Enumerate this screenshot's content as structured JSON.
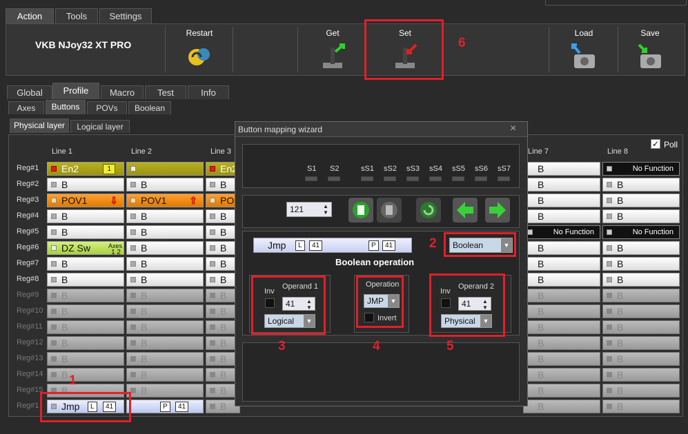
{
  "tabs_top": [
    "Action",
    "Tools",
    "Settings"
  ],
  "device_name": "VKB NJoy32 XT PRO",
  "toolbar": {
    "restart": "Restart",
    "get": "Get",
    "set": "Set",
    "load": "Load",
    "save": "Save"
  },
  "tabs_main": [
    "Global",
    "Profile",
    "Macro",
    "Test",
    "Info"
  ],
  "tabs_sub": [
    "Axes",
    "Buttons",
    "POVs",
    "Boolean"
  ],
  "tabs_layer": [
    "Physical layer",
    "Logical layer"
  ],
  "poll_label": "Poll",
  "columns": [
    "Line 1",
    "Line 2",
    "Line 3",
    "Line 7",
    "Line 8"
  ],
  "rows": [
    "Reg#1",
    "Reg#2",
    "Reg#3",
    "Reg#4",
    "Reg#5",
    "Reg#6",
    "Reg#7",
    "Reg#8",
    "Reg#9",
    "Reg#10",
    "Reg#11",
    "Reg#12",
    "Reg#13",
    "Reg#14",
    "Reg#15",
    "Reg#1"
  ],
  "cells": {
    "en2": "En2",
    "en2_badge": "1",
    "en2_short": "En2",
    "b": "B",
    "pov1": "POV1",
    "pov1_short": "PO",
    "dzsw": "DZ Sw",
    "axes": "Axes",
    "axes_nums": "1 2",
    "nofunc": "No Function",
    "jmp": "Jmp",
    "l": "L",
    "p": "P",
    "n41": "41"
  },
  "dialog": {
    "title": "Button mapping wizard",
    "close": "×",
    "leds": [
      "S1",
      "S2",
      "sS1",
      "sS2",
      "sS3",
      "sS4",
      "sS5",
      "sS6",
      "sS7"
    ],
    "spin_value": "121",
    "jmp": "Jmp",
    "l": "L",
    "p": "P",
    "n41": "41",
    "type_select": "Boolean",
    "section_title": "Boolean operation",
    "op1": {
      "inv": "Inv",
      "title": "Operand 1",
      "value": "41",
      "select": "Logical"
    },
    "op": {
      "title": "Operation",
      "select": "JMP",
      "invert": "Invert"
    },
    "op2": {
      "inv": "Inv",
      "title": "Operand 2",
      "value": "41",
      "select": "Physical"
    }
  },
  "annotations": [
    "1",
    "2",
    "3",
    "4",
    "5",
    "6"
  ],
  "colors": {
    "accent_red": "#e0202a",
    "olive": "#b8b020",
    "orange": "#ffa030",
    "lime": "#c0e060"
  }
}
